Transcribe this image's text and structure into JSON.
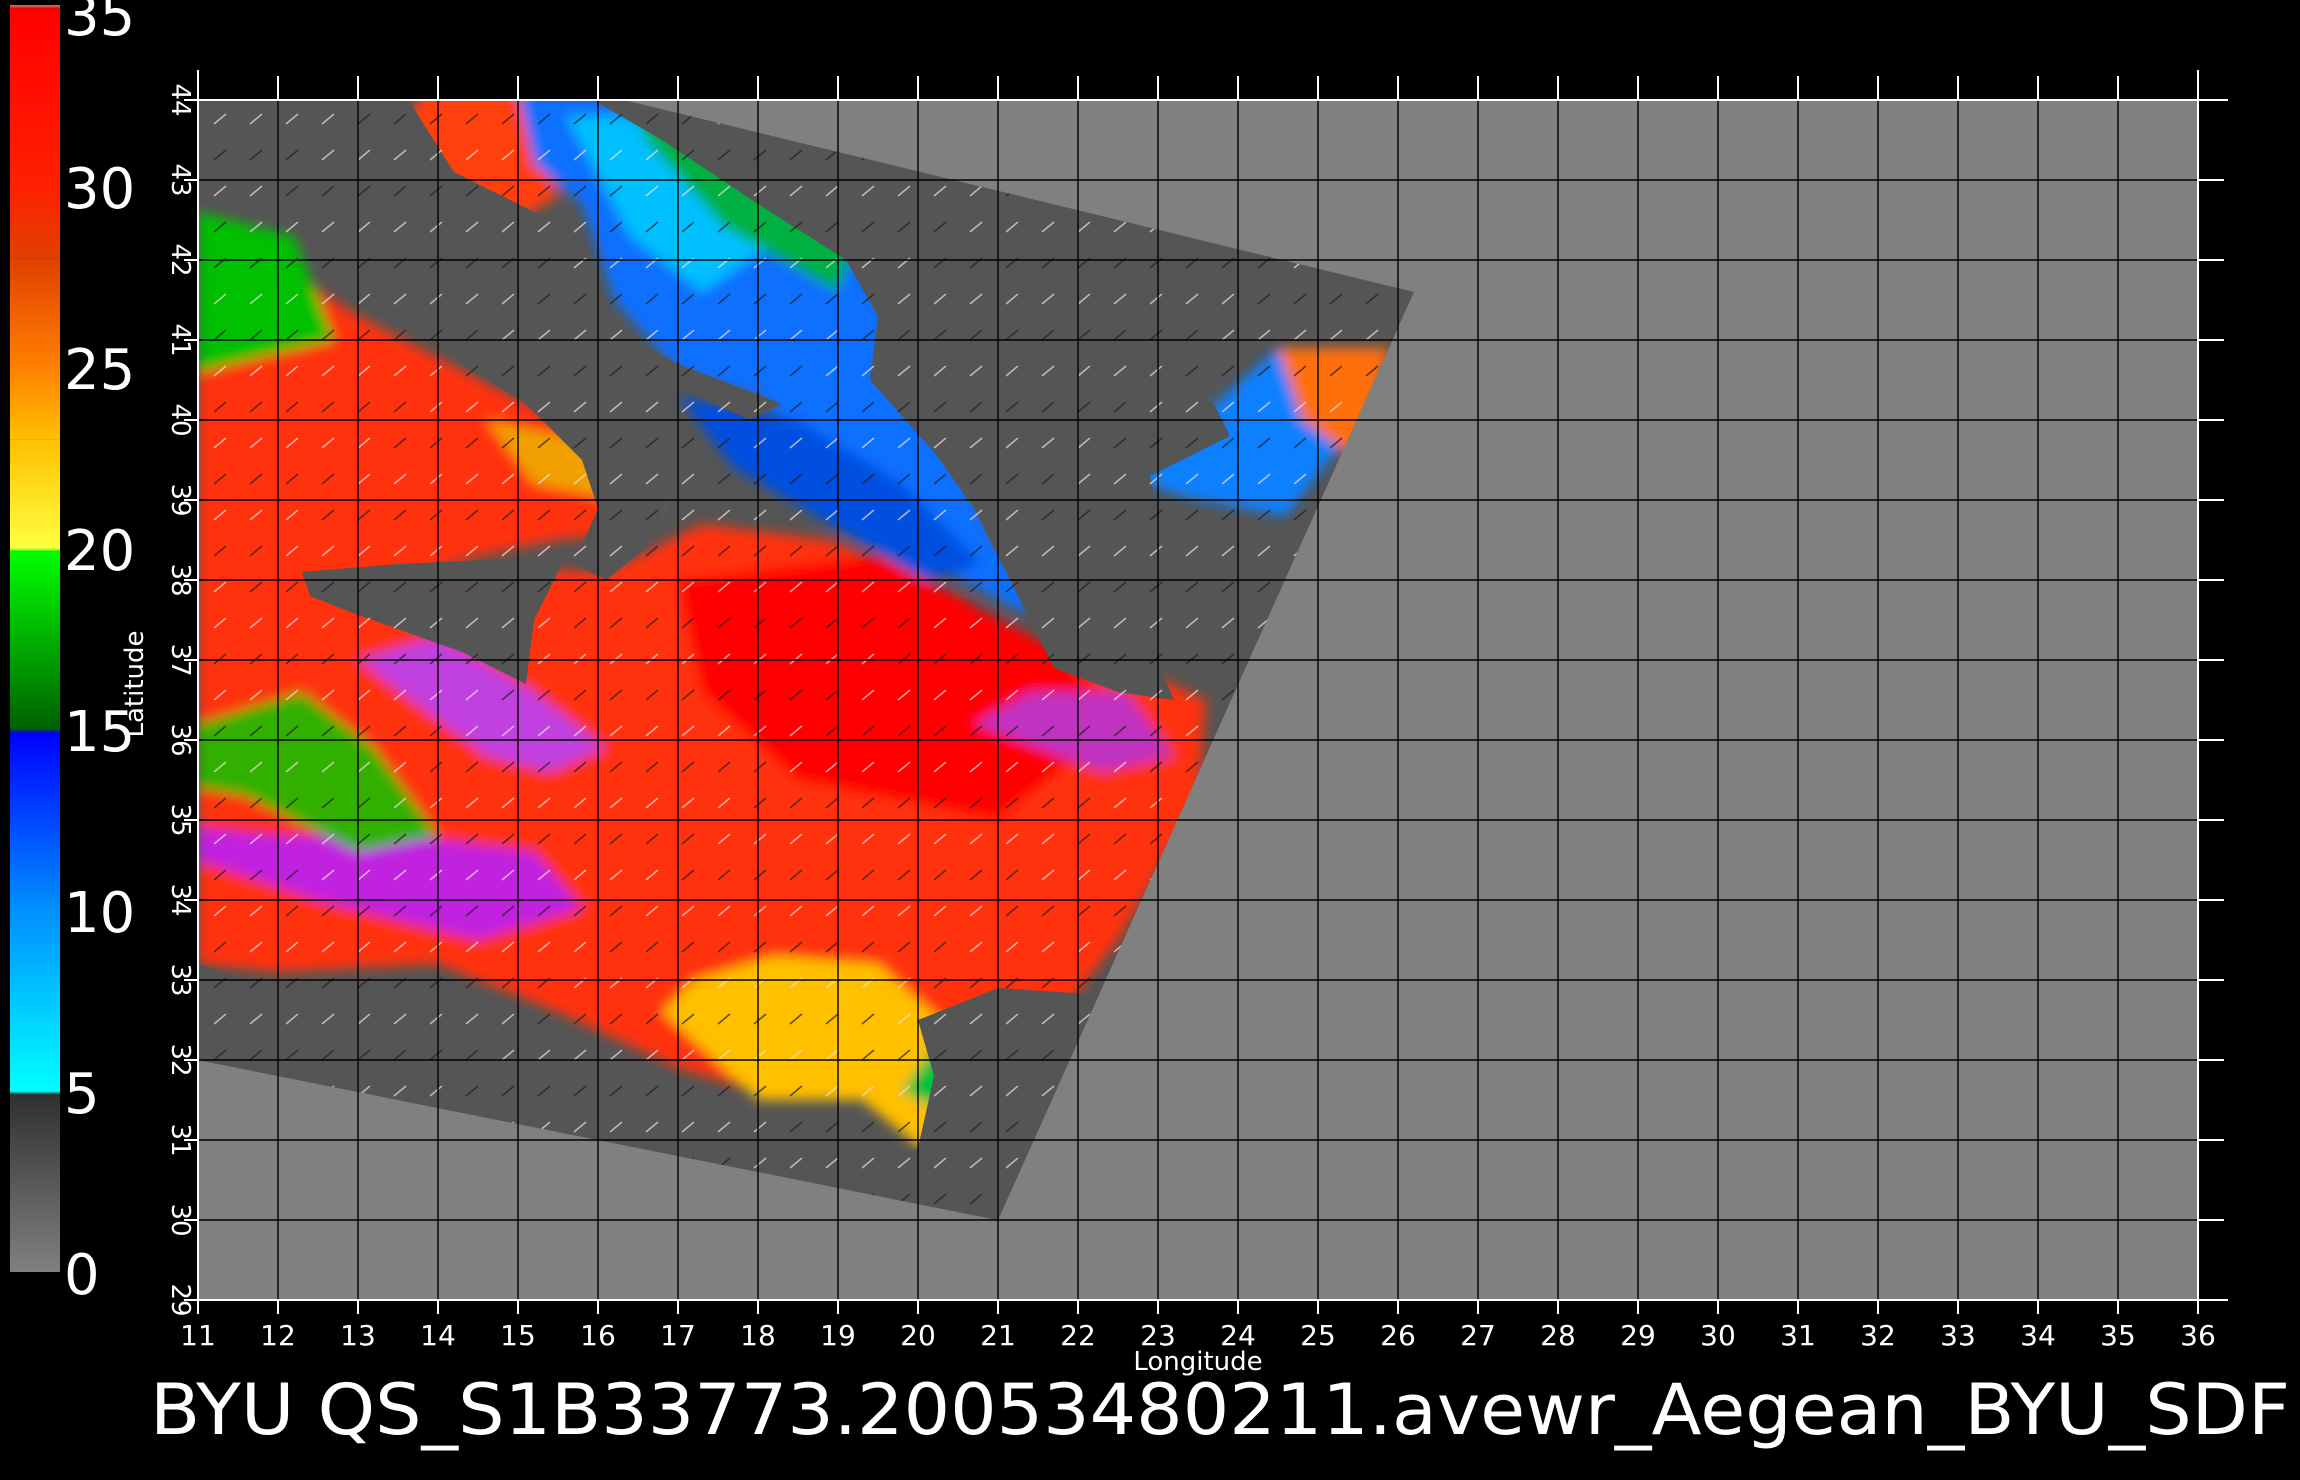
{
  "chart_data": {
    "type": "heatmap",
    "title": "BYU  QS_S1B33773.20053480211.avewr_Aegean_BYU_SDF",
    "xlabel": "Longitude",
    "ylabel": "Latitude",
    "xlim": [
      11,
      36
    ],
    "ylim": [
      29,
      44
    ],
    "x_ticks": [
      "11",
      "12",
      "13",
      "14",
      "15",
      "16",
      "17",
      "18",
      "19",
      "20",
      "21",
      "22",
      "23",
      "24",
      "25",
      "26",
      "27",
      "28",
      "29",
      "30",
      "31",
      "32",
      "33",
      "34",
      "35",
      "36"
    ],
    "y_ticks": [
      "29",
      "30",
      "31",
      "32",
      "33",
      "34",
      "35",
      "36",
      "37",
      "38",
      "39",
      "40",
      "41",
      "42",
      "43",
      "44"
    ],
    "grid": true,
    "colorbar": {
      "min": 0,
      "max": 35,
      "labels": [
        "35",
        "30",
        "25",
        "20",
        "15",
        "10",
        "5",
        "0"
      ],
      "label_values": [
        35,
        30,
        25,
        20,
        15,
        10,
        5,
        0
      ],
      "stops": [
        {
          "value": 0,
          "color": "#808080"
        },
        {
          "value": 4.9,
          "color": "#303030"
        },
        {
          "value": 5,
          "color": "#00ffff"
        },
        {
          "value": 10,
          "color": "#0090ff"
        },
        {
          "value": 14.9,
          "color": "#0000ff"
        },
        {
          "value": 15,
          "color": "#006000"
        },
        {
          "value": 19.9,
          "color": "#00ff00"
        },
        {
          "value": 20,
          "color": "#ffff40"
        },
        {
          "value": 23,
          "color": "#ffc000"
        },
        {
          "value": 25,
          "color": "#ff8000"
        },
        {
          "value": 28,
          "color": "#e04000"
        },
        {
          "value": 30,
          "color": "#ff2000"
        },
        {
          "value": 34.9,
          "color": "#ff0000"
        },
        {
          "value": 35,
          "color": "#c08060"
        }
      ]
    },
    "swath_polygon_lonlat": [
      [
        11,
        32
      ],
      [
        21,
        30
      ],
      [
        26.2,
        41.6
      ],
      [
        15.5,
        44.2
      ],
      [
        11,
        44.2
      ]
    ],
    "land_color": "#555555",
    "background_color": "#808080",
    "gridline_color": "#000000",
    "wind_vectors": true
  }
}
